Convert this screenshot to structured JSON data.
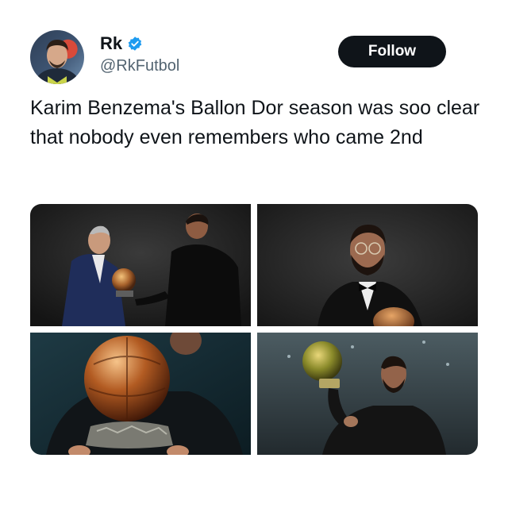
{
  "author": {
    "name": "Rk",
    "handle": "@RkFutbol",
    "verified": true,
    "avatar_icon": "profile-photo"
  },
  "follow_label": "Follow",
  "tweet": {
    "text": "Karim Benzema's Ballon Dor season was soo clear that nobody even remembers who came 2nd"
  },
  "media": [
    {
      "icon": "photo-trophy-handover"
    },
    {
      "icon": "photo-benzema-bowtie"
    },
    {
      "icon": "photo-golden-ball-closeup"
    },
    {
      "icon": "photo-benzema-raising-ball"
    }
  ],
  "colors": {
    "text": "#0f1419",
    "secondary": "#536471",
    "button_bg": "#0f1419",
    "button_text": "#ffffff",
    "verified": "#1d9bf0"
  }
}
